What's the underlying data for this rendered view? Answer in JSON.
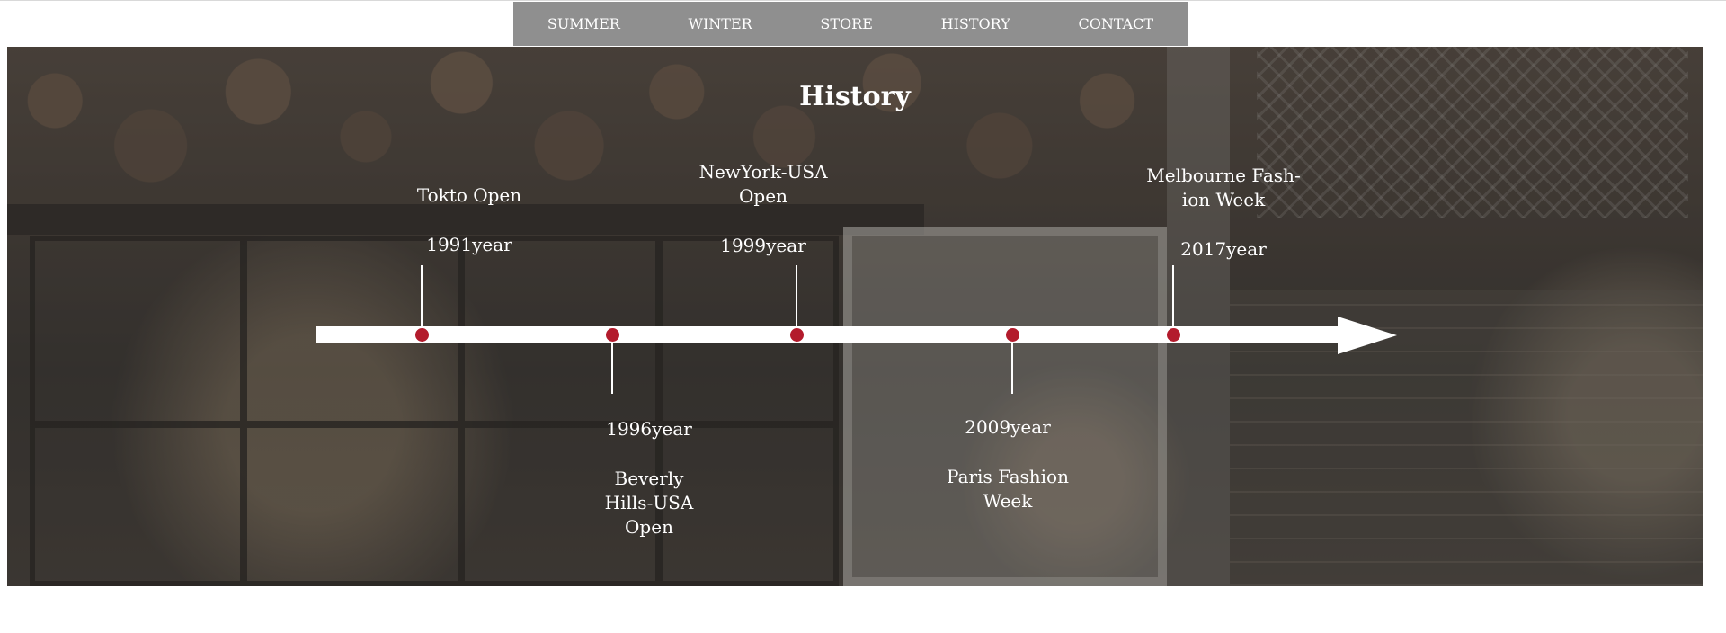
{
  "nav": {
    "items": [
      "SUMMER",
      "WINTER",
      "STORE",
      "HISTORY",
      "CONTACT"
    ]
  },
  "history": {
    "title": "History",
    "events": [
      {
        "event": "Tokto Open",
        "year": "1991year"
      },
      {
        "event": "Beverly Hills-USA Open",
        "year": "1996year"
      },
      {
        "event": "NewYork-USA Open",
        "year": "1999year"
      },
      {
        "event": "Paris Fashion Week",
        "year": "2009year"
      },
      {
        "event": "Melbourne Fash-ion Week",
        "year": "2017year"
      }
    ]
  },
  "colors": {
    "nav_bg": "#8f8f8f",
    "timeline": "#ffffff",
    "marker": "#b31b2c"
  }
}
